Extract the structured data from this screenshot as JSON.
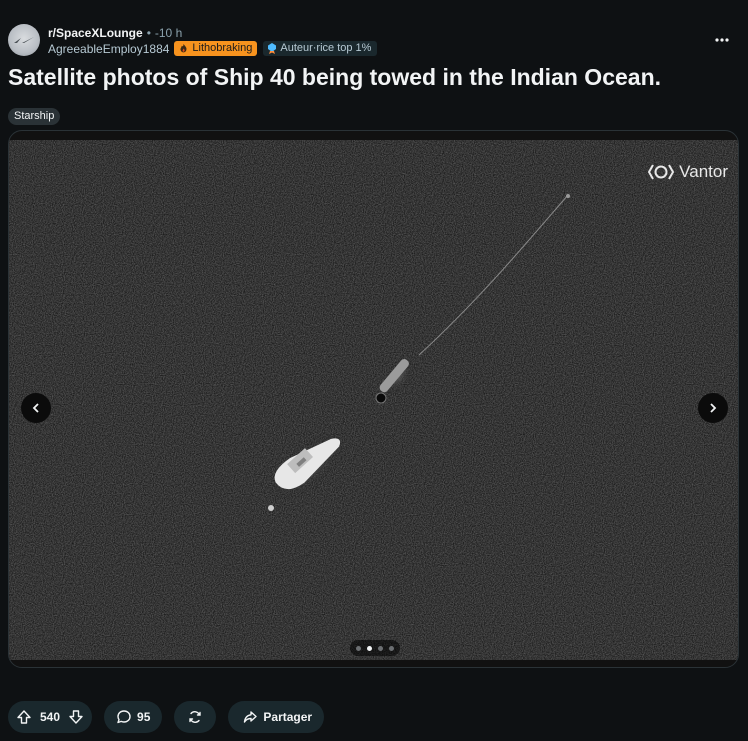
{
  "post": {
    "subreddit": "r/SpaceXLounge",
    "separator": "•",
    "time": "-10 h",
    "author": "AgreeableEmploy1884",
    "flair": "Lithobraking",
    "badge": "Auteur·rice top 1%",
    "title": "Satellite photos of Ship 40 being towed in the Indian Ocean.",
    "tag": "Starship"
  },
  "media": {
    "watermark": "Vantor",
    "gallery": {
      "total_images": 4,
      "current_index": 2
    }
  },
  "actions": {
    "upvotes": "540",
    "comments": "95",
    "share_label": "Partager"
  },
  "colors": {
    "background": "#0e1113",
    "flair_bg": "#f7931e",
    "pill_bg": "#1a282d",
    "muted_text": "#8ba2ad"
  },
  "icons": [
    "spacex-logo-icon",
    "fire-icon",
    "top-author-icon",
    "more-icon",
    "chevron-left-icon",
    "chevron-right-icon",
    "upvote-icon",
    "downvote-icon",
    "comment-icon",
    "crosspost-icon",
    "share-icon",
    "vantor-logo-icon"
  ]
}
